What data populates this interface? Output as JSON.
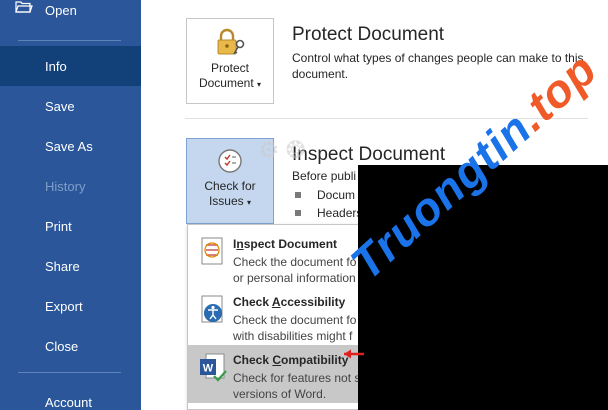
{
  "sidebar": {
    "items": [
      {
        "label": "Open"
      },
      {
        "label": "Info"
      },
      {
        "label": "Save"
      },
      {
        "label": "Save As"
      },
      {
        "label": "History"
      },
      {
        "label": "Print"
      },
      {
        "label": "Share"
      },
      {
        "label": "Export"
      },
      {
        "label": "Close"
      },
      {
        "label": "Account"
      }
    ]
  },
  "protect": {
    "button_line1": "Protect",
    "button_line2": "Document",
    "title": "Protect Document",
    "desc_line1": "Control what types of changes people can make to this",
    "desc_line2": "document."
  },
  "inspect": {
    "button_line1": "Check for",
    "button_line2": "Issues",
    "title": "Inspect Document",
    "desc": "Before publi",
    "bullets": [
      "Docum",
      "Headers"
    ]
  },
  "menu": {
    "items": [
      {
        "title_pre": "I",
        "title_u": "n",
        "title_post": "spect Document",
        "desc1": "Check the document fo",
        "desc2": "or personal information"
      },
      {
        "title_pre": "Check ",
        "title_u": "A",
        "title_post": "ccessibility",
        "desc1": "Check the document fo",
        "desc2": "with disabilities might f"
      },
      {
        "title_pre": "Check ",
        "title_u": "C",
        "title_post": "ompatibility",
        "desc1": "Check for features not s",
        "desc2": "versions of Word."
      }
    ]
  },
  "watermark": {
    "part1": "Truongtin",
    "part2": ".top"
  },
  "colors": {
    "sidebar": "#2b579a",
    "sidebar_active": "#124078",
    "watermark_blue": "#1a73e8",
    "watermark_orange": "#f05a28"
  }
}
